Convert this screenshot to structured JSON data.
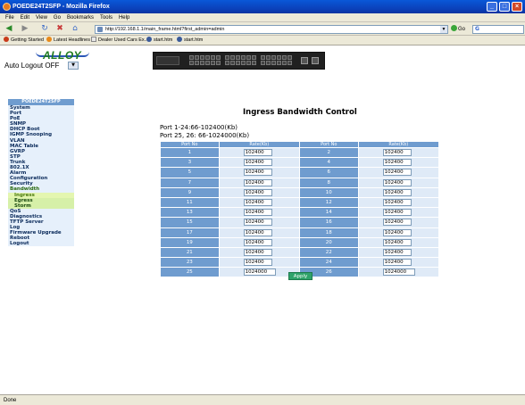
{
  "window": {
    "title": "POEDE24T2SFP - Mozilla Firefox",
    "buttons": [
      "_",
      "□",
      "×"
    ]
  },
  "menu": [
    "File",
    "Edit",
    "View",
    "Go",
    "Bookmarks",
    "Tools",
    "Help"
  ],
  "nav": {
    "url": "http://192.168.1.1/main_frame.html?first_admin=admin",
    "go_label": "Go",
    "search_engine": "G"
  },
  "bookmarks": [
    "Getting Started",
    "Latest Headlines",
    "Dealer Used Cars Ex...",
    "start.htm",
    "start.htm"
  ],
  "header": {
    "logo_text": "ALLOY",
    "autologout_label": "Auto Logout OFF"
  },
  "sidebar": {
    "title": "POEDE24T2SFP",
    "items": [
      {
        "label": "System",
        "type": "item"
      },
      {
        "label": "Port",
        "type": "item"
      },
      {
        "label": "PoE",
        "type": "item"
      },
      {
        "label": "SNMP",
        "type": "item"
      },
      {
        "label": "DHCP Boot",
        "type": "item"
      },
      {
        "label": "IGMP Snooping",
        "type": "item"
      },
      {
        "label": "VLAN",
        "type": "item"
      },
      {
        "label": "MAC Table",
        "type": "item"
      },
      {
        "label": "GVRP",
        "type": "item"
      },
      {
        "label": "STP",
        "type": "item"
      },
      {
        "label": "Trunk",
        "type": "item"
      },
      {
        "label": "802.1X",
        "type": "item"
      },
      {
        "label": "Alarm",
        "type": "item"
      },
      {
        "label": "Configuration",
        "type": "item"
      },
      {
        "label": "Security",
        "type": "item"
      },
      {
        "label": "Bandwidth",
        "type": "section"
      },
      {
        "label": "Ingress",
        "type": "sub-active"
      },
      {
        "label": "Egress",
        "type": "sub"
      },
      {
        "label": "Storm",
        "type": "sub"
      },
      {
        "label": "QoS",
        "type": "item"
      },
      {
        "label": "Diagnostics",
        "type": "item"
      },
      {
        "label": "TFTP Server",
        "type": "item"
      },
      {
        "label": "Log",
        "type": "item"
      },
      {
        "label": "Firmware Upgrade",
        "type": "item"
      },
      {
        "label": "Reboot",
        "type": "item"
      },
      {
        "label": "Logout",
        "type": "item"
      }
    ]
  },
  "main": {
    "heading": "Ingress Bandwidth Control",
    "port_info_1": "Port 1-24:66-102400(Kb)",
    "port_info_2": "Port 25, 26: 66-1024000(Kb)",
    "columns": [
      "Port No",
      "Rate(Kb)",
      "Port No",
      "Rate(Kb)"
    ],
    "rows": [
      {
        "p1": "1",
        "r1": "102400",
        "p2": "2",
        "r2": "102400"
      },
      {
        "p1": "3",
        "r1": "102400",
        "p2": "4",
        "r2": "102400"
      },
      {
        "p1": "5",
        "r1": "102400",
        "p2": "6",
        "r2": "102400"
      },
      {
        "p1": "7",
        "r1": "102400",
        "p2": "8",
        "r2": "102400"
      },
      {
        "p1": "9",
        "r1": "102400",
        "p2": "10",
        "r2": "102400"
      },
      {
        "p1": "11",
        "r1": "102400",
        "p2": "12",
        "r2": "102400"
      },
      {
        "p1": "13",
        "r1": "102400",
        "p2": "14",
        "r2": "102400"
      },
      {
        "p1": "15",
        "r1": "102400",
        "p2": "16",
        "r2": "102400"
      },
      {
        "p1": "17",
        "r1": "102400",
        "p2": "18",
        "r2": "102400"
      },
      {
        "p1": "19",
        "r1": "102400",
        "p2": "20",
        "r2": "102400"
      },
      {
        "p1": "21",
        "r1": "102400",
        "p2": "22",
        "r2": "102400"
      },
      {
        "p1": "23",
        "r1": "102400",
        "p2": "24",
        "r2": "102400"
      },
      {
        "p1": "25",
        "r1": "1024000",
        "p2": "26",
        "r2": "1024000"
      }
    ],
    "apply_label": "Apply"
  },
  "status": {
    "text": "Done"
  },
  "colors": {
    "table_header": "#6f9ccf",
    "cell_bg": "#dfeaf7",
    "apply": "#2fa36a",
    "submenu": "#d6f0a8",
    "logo": "#1e7a1e"
  }
}
